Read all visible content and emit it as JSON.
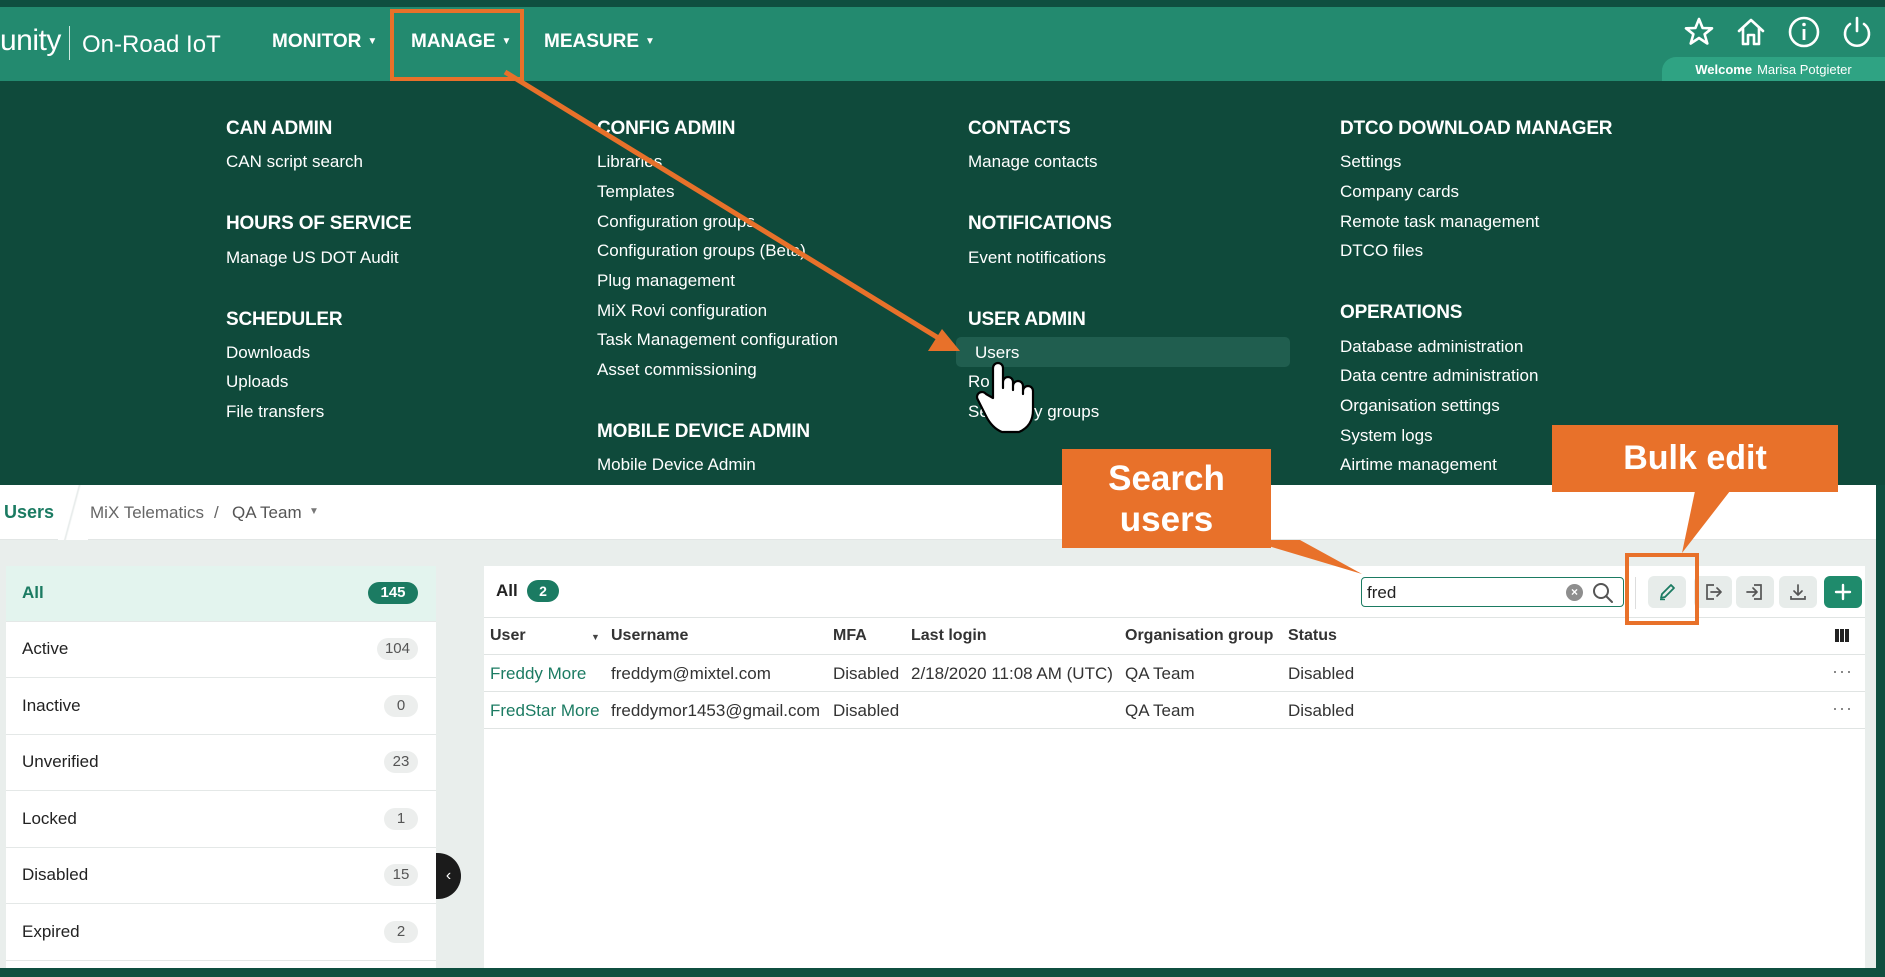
{
  "header": {
    "logo": "unity",
    "app_name": "On-Road IoT",
    "menus": [
      {
        "label": "MONITOR"
      },
      {
        "label": "MANAGE"
      },
      {
        "label": "MEASURE"
      }
    ],
    "welcome_label": "Welcome",
    "welcome_user": "Marisa Potgieter",
    "icons": [
      "star-icon",
      "home-icon",
      "info-icon",
      "power-icon"
    ]
  },
  "mega_menu": {
    "can_admin": {
      "title": "CAN ADMIN",
      "items": [
        "CAN script search"
      ]
    },
    "hours_of_service": {
      "title": "HOURS OF SERVICE",
      "items": [
        "Manage US DOT Audit"
      ]
    },
    "scheduler": {
      "title": "SCHEDULER",
      "items": [
        "Downloads",
        "Uploads",
        "File transfers"
      ]
    },
    "config_admin": {
      "title": "CONFIG ADMIN",
      "items": [
        "Libraries",
        "Templates",
        "Configuration groups",
        "Configuration groups (Beta)",
        "Plug management",
        "MiX Rovi configuration",
        "Task Management configuration",
        "Asset commissioning"
      ]
    },
    "mobile_device_admin": {
      "title": "MOBILE DEVICE ADMIN",
      "items": [
        "Mobile Device Admin"
      ]
    },
    "contacts": {
      "title": "CONTACTS",
      "items": [
        "Manage contacts"
      ]
    },
    "notifications": {
      "title": "NOTIFICATIONS",
      "items": [
        "Event notifications"
      ]
    },
    "user_admin": {
      "title": "USER ADMIN",
      "items": [
        "Users",
        "Ro",
        "Se",
        "y groups"
      ]
    },
    "dtco": {
      "title": "DTCO DOWNLOAD MANAGER",
      "items": [
        "Settings",
        "Company cards",
        "Remote task management",
        "DTCO files"
      ]
    },
    "operations": {
      "title": "OPERATIONS",
      "items": [
        "Database administration",
        "Data centre administration",
        "Organisation settings",
        "System logs",
        "Airtime management"
      ]
    }
  },
  "breadcrumb": {
    "page": "Users",
    "organisation": "MiX Telematics",
    "separator": "/",
    "group": "QA Team"
  },
  "sidebar": {
    "items": [
      {
        "label": "All",
        "count": "145"
      },
      {
        "label": "Active",
        "count": "104"
      },
      {
        "label": "Inactive",
        "count": "0"
      },
      {
        "label": "Unverified",
        "count": "23"
      },
      {
        "label": "Locked",
        "count": "1"
      },
      {
        "label": "Disabled",
        "count": "15"
      },
      {
        "label": "Expired",
        "count": "2"
      }
    ]
  },
  "list": {
    "title": "All",
    "count": "2",
    "search_value": "fred",
    "clear_symbol": "×",
    "columns": [
      "User",
      "Username",
      "MFA",
      "Last login",
      "Organisation group",
      "Status"
    ],
    "rows": [
      {
        "user": "Freddy More",
        "username": "freddym@mixtel.com",
        "mfa": "Disabled",
        "last_login": "2/18/2020 11:08 AM (UTC)",
        "org_group": "QA Team",
        "status": "Disabled",
        "menu": "···"
      },
      {
        "user": "FredStar More",
        "username": "freddymor1453@gmail.com",
        "mfa": "Disabled",
        "last_login": "",
        "org_group": "QA Team",
        "status": "Disabled",
        "menu": "···"
      }
    ]
  },
  "annotations": {
    "search_callout_line1": "Search",
    "search_callout_line2": "users",
    "bulk_edit_callout": "Bulk edit",
    "color": "#e8712a"
  },
  "colors": {
    "nav": "#238a6f",
    "mega_menu": "#0f4a3b",
    "accent": "#1b7b62"
  }
}
